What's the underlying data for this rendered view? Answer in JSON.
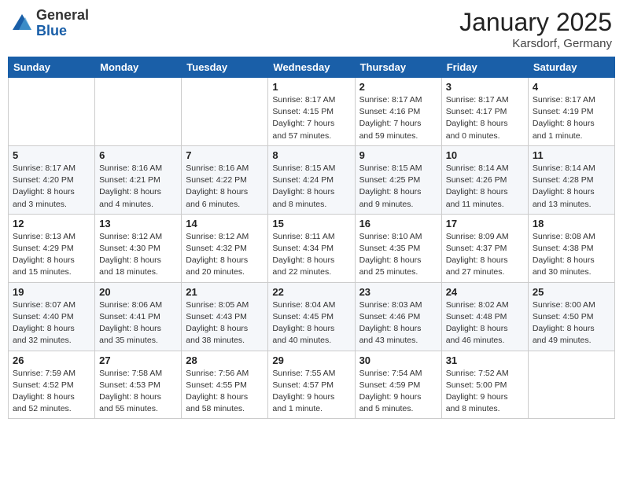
{
  "header": {
    "logo_line1": "General",
    "logo_line2": "Blue",
    "month_year": "January 2025",
    "location": "Karsdorf, Germany"
  },
  "weekdays": [
    "Sunday",
    "Monday",
    "Tuesday",
    "Wednesday",
    "Thursday",
    "Friday",
    "Saturday"
  ],
  "weeks": [
    [
      {
        "day": "",
        "info": ""
      },
      {
        "day": "",
        "info": ""
      },
      {
        "day": "",
        "info": ""
      },
      {
        "day": "1",
        "info": "Sunrise: 8:17 AM\nSunset: 4:15 PM\nDaylight: 7 hours and 57 minutes."
      },
      {
        "day": "2",
        "info": "Sunrise: 8:17 AM\nSunset: 4:16 PM\nDaylight: 7 hours and 59 minutes."
      },
      {
        "day": "3",
        "info": "Sunrise: 8:17 AM\nSunset: 4:17 PM\nDaylight: 8 hours and 0 minutes."
      },
      {
        "day": "4",
        "info": "Sunrise: 8:17 AM\nSunset: 4:19 PM\nDaylight: 8 hours and 1 minute."
      }
    ],
    [
      {
        "day": "5",
        "info": "Sunrise: 8:17 AM\nSunset: 4:20 PM\nDaylight: 8 hours and 3 minutes."
      },
      {
        "day": "6",
        "info": "Sunrise: 8:16 AM\nSunset: 4:21 PM\nDaylight: 8 hours and 4 minutes."
      },
      {
        "day": "7",
        "info": "Sunrise: 8:16 AM\nSunset: 4:22 PM\nDaylight: 8 hours and 6 minutes."
      },
      {
        "day": "8",
        "info": "Sunrise: 8:15 AM\nSunset: 4:24 PM\nDaylight: 8 hours and 8 minutes."
      },
      {
        "day": "9",
        "info": "Sunrise: 8:15 AM\nSunset: 4:25 PM\nDaylight: 8 hours and 9 minutes."
      },
      {
        "day": "10",
        "info": "Sunrise: 8:14 AM\nSunset: 4:26 PM\nDaylight: 8 hours and 11 minutes."
      },
      {
        "day": "11",
        "info": "Sunrise: 8:14 AM\nSunset: 4:28 PM\nDaylight: 8 hours and 13 minutes."
      }
    ],
    [
      {
        "day": "12",
        "info": "Sunrise: 8:13 AM\nSunset: 4:29 PM\nDaylight: 8 hours and 15 minutes."
      },
      {
        "day": "13",
        "info": "Sunrise: 8:12 AM\nSunset: 4:30 PM\nDaylight: 8 hours and 18 minutes."
      },
      {
        "day": "14",
        "info": "Sunrise: 8:12 AM\nSunset: 4:32 PM\nDaylight: 8 hours and 20 minutes."
      },
      {
        "day": "15",
        "info": "Sunrise: 8:11 AM\nSunset: 4:34 PM\nDaylight: 8 hours and 22 minutes."
      },
      {
        "day": "16",
        "info": "Sunrise: 8:10 AM\nSunset: 4:35 PM\nDaylight: 8 hours and 25 minutes."
      },
      {
        "day": "17",
        "info": "Sunrise: 8:09 AM\nSunset: 4:37 PM\nDaylight: 8 hours and 27 minutes."
      },
      {
        "day": "18",
        "info": "Sunrise: 8:08 AM\nSunset: 4:38 PM\nDaylight: 8 hours and 30 minutes."
      }
    ],
    [
      {
        "day": "19",
        "info": "Sunrise: 8:07 AM\nSunset: 4:40 PM\nDaylight: 8 hours and 32 minutes."
      },
      {
        "day": "20",
        "info": "Sunrise: 8:06 AM\nSunset: 4:41 PM\nDaylight: 8 hours and 35 minutes."
      },
      {
        "day": "21",
        "info": "Sunrise: 8:05 AM\nSunset: 4:43 PM\nDaylight: 8 hours and 38 minutes."
      },
      {
        "day": "22",
        "info": "Sunrise: 8:04 AM\nSunset: 4:45 PM\nDaylight: 8 hours and 40 minutes."
      },
      {
        "day": "23",
        "info": "Sunrise: 8:03 AM\nSunset: 4:46 PM\nDaylight: 8 hours and 43 minutes."
      },
      {
        "day": "24",
        "info": "Sunrise: 8:02 AM\nSunset: 4:48 PM\nDaylight: 8 hours and 46 minutes."
      },
      {
        "day": "25",
        "info": "Sunrise: 8:00 AM\nSunset: 4:50 PM\nDaylight: 8 hours and 49 minutes."
      }
    ],
    [
      {
        "day": "26",
        "info": "Sunrise: 7:59 AM\nSunset: 4:52 PM\nDaylight: 8 hours and 52 minutes."
      },
      {
        "day": "27",
        "info": "Sunrise: 7:58 AM\nSunset: 4:53 PM\nDaylight: 8 hours and 55 minutes."
      },
      {
        "day": "28",
        "info": "Sunrise: 7:56 AM\nSunset: 4:55 PM\nDaylight: 8 hours and 58 minutes."
      },
      {
        "day": "29",
        "info": "Sunrise: 7:55 AM\nSunset: 4:57 PM\nDaylight: 9 hours and 1 minute."
      },
      {
        "day": "30",
        "info": "Sunrise: 7:54 AM\nSunset: 4:59 PM\nDaylight: 9 hours and 5 minutes."
      },
      {
        "day": "31",
        "info": "Sunrise: 7:52 AM\nSunset: 5:00 PM\nDaylight: 9 hours and 8 minutes."
      },
      {
        "day": "",
        "info": ""
      }
    ]
  ]
}
